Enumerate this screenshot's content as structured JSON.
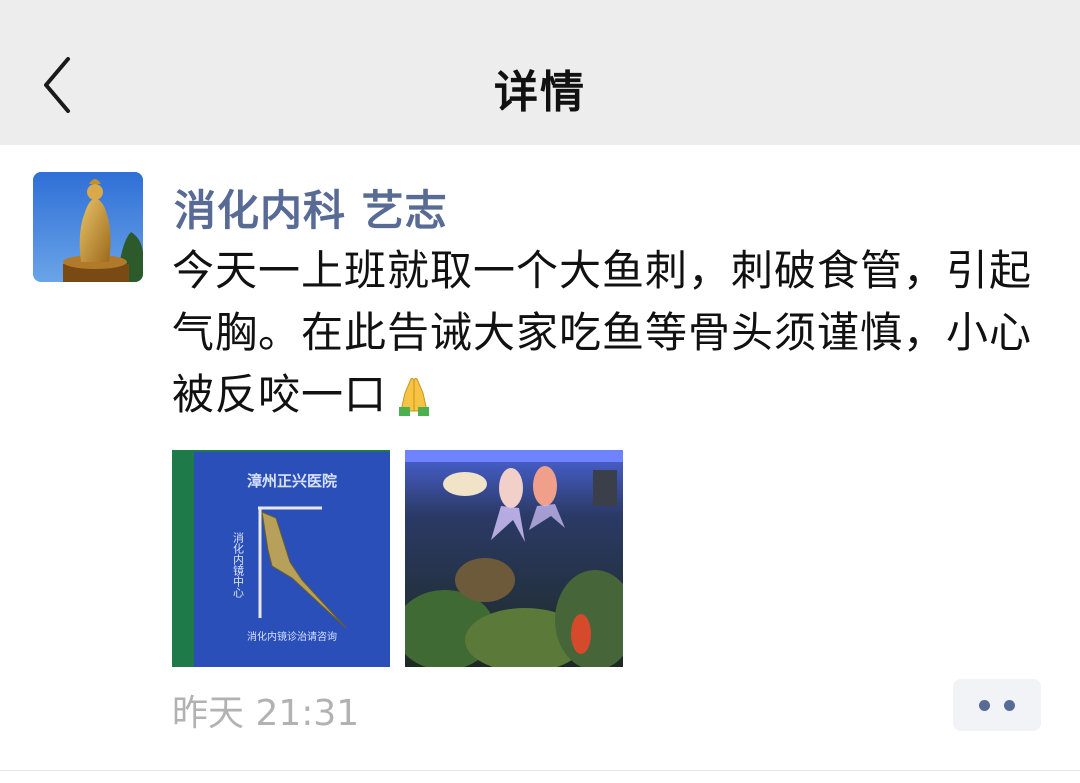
{
  "nav": {
    "title": "详情",
    "back_icon": "chevron-left-icon"
  },
  "post": {
    "author": "消化内科 艺志",
    "text": "今天一上班就取一个大鱼刺，刺破食管，引起气胸。在此告诫大家吃鱼等骨头须谨慎，小心被反咬一口",
    "emoji": "pray-emoji-icon",
    "photos": [
      {
        "name": "fish-bone-photo",
        "caption": "漳州正兴医院",
        "side_text": "消化内镜中心",
        "footer": "消化内镜诊治请咨询"
      },
      {
        "name": "goldfish-tank-photo"
      }
    ],
    "timestamp": "昨天 21:31",
    "more_icon": "more-dots-icon"
  },
  "colors": {
    "nav_bg": "#ededed",
    "author": "#576b95",
    "timestamp": "#b2b2b2",
    "text": "#111111"
  }
}
